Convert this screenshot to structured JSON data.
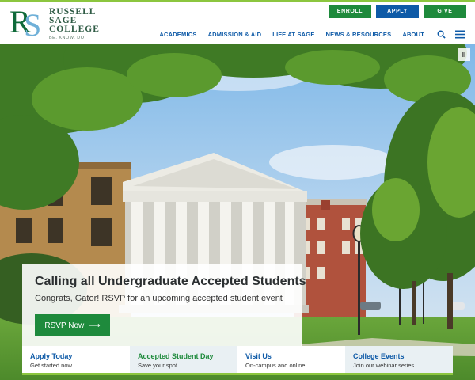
{
  "logo": {
    "monogram_r": "R",
    "monogram_s": "S",
    "lines": [
      "RUSSELL",
      "SAGE",
      "COLLEGE"
    ],
    "tagline": "BE. KNOW. DO."
  },
  "utility": {
    "enroll": "ENROLL",
    "apply": "APPLY",
    "give": "GIVE"
  },
  "nav": {
    "items": [
      "ACADEMICS",
      "ADMISSION & AID",
      "LIFE AT SAGE",
      "NEWS & RESOURCES",
      "ABOUT"
    ],
    "search_icon": "search-icon",
    "menu_icon": "hamburger-menu-icon"
  },
  "hero": {
    "pause_label": "II",
    "promo_title": "Calling all Undergraduate Accepted Students",
    "promo_subtitle": "Congrats, Gator! RSVP for an upcoming accepted student event",
    "button_label": "RSVP Now",
    "button_arrow": "⟶"
  },
  "quick_links": [
    {
      "title": "Apply Today",
      "subtitle": "Get started now"
    },
    {
      "title": "Accepted Student Day",
      "subtitle": "Save your spot"
    },
    {
      "title": "Visit Us",
      "subtitle": "On-campus and online"
    },
    {
      "title": "College Events",
      "subtitle": "Join our webinar series"
    }
  ],
  "colors": {
    "brand_green": "#1e8a3c",
    "brand_blue": "#0e5aa7",
    "accent_lime": "#8cc63f"
  }
}
